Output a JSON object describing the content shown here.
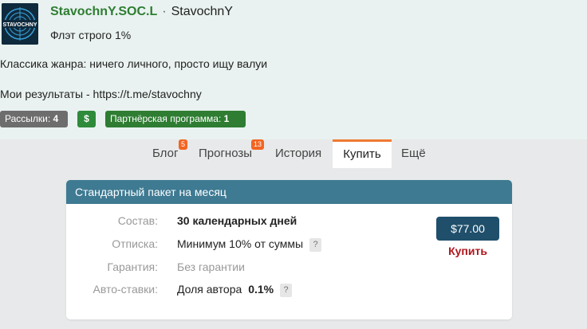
{
  "profile": {
    "avatar_text": "STAVOCHNY",
    "name": "StavochnY.SOC.L",
    "separator": "·",
    "handle": "StavochnY",
    "tagline": "Флэт строго 1%",
    "description_line1": "Классика жанра: ничего личного, просто ищу валуи",
    "description_line2": "Мои результаты - https://t.me/stavochny",
    "badges": {
      "mailings_label": "Рассылки:",
      "mailings_count": "4",
      "dollar": "$",
      "partner_label": "Партнёрская программа:",
      "partner_count": "1"
    }
  },
  "tabs": [
    {
      "label": "Блог",
      "count": "5"
    },
    {
      "label": "Прогнозы",
      "count": "13"
    },
    {
      "label": "История"
    },
    {
      "label": "Купить",
      "active": true
    },
    {
      "label": "Ещё"
    }
  ],
  "package": {
    "title": "Стандартный пакет на месяц",
    "rows": [
      {
        "label": "Состав:",
        "value": "30 календарных дней"
      },
      {
        "label": "Отписка:",
        "value": "Минимум 10% от суммы",
        "help": "?"
      },
      {
        "label": "Гарантия:",
        "value": "Без гарантии"
      },
      {
        "label": "Авто-ставки:",
        "value": "Доля автора",
        "value_bold": "0.1%",
        "help": "?"
      }
    ],
    "price": "$77.00",
    "buy_label": "Купить"
  },
  "colors": {
    "accent_green": "#2e7d32",
    "tab_active_border": "#f07a32",
    "count_badge": "#f26522",
    "card_header": "#3e7a92",
    "price_button": "#1f4f6b",
    "buy_link": "#b0161d"
  }
}
